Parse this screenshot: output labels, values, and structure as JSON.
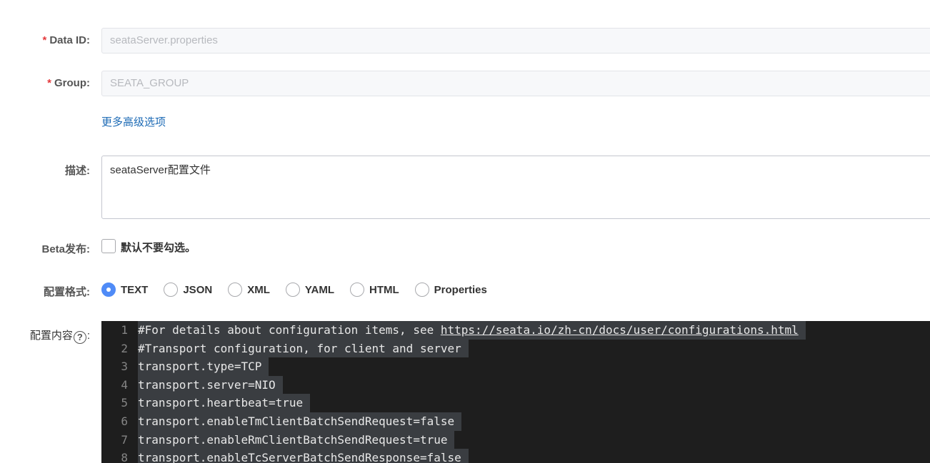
{
  "form": {
    "data_id": {
      "label": "Data ID:",
      "required": "*",
      "value": "seataServer.properties"
    },
    "group": {
      "label": "Group:",
      "required": "*",
      "value": "SEATA_GROUP"
    },
    "advanced_link": "更多高级选项",
    "description": {
      "label": "描述:",
      "value": "seataServer配置文件"
    },
    "beta": {
      "label": "Beta发布:",
      "checkbox_text": "默认不要勾选。",
      "checked": false
    },
    "format": {
      "label": "配置格式:",
      "options": [
        "TEXT",
        "JSON",
        "XML",
        "YAML",
        "HTML",
        "Properties"
      ],
      "selected": "TEXT"
    },
    "content": {
      "label": "配置内容",
      "help_glyph": "?",
      "colon": ":"
    }
  },
  "editor": {
    "lines": [
      {
        "no": "1",
        "prefix": "#For details about configuration items, see ",
        "link": "https://seata.io/zh-cn/docs/user/configurations.html"
      },
      {
        "no": "2",
        "prefix": "#Transport configuration, for client and server",
        "link": ""
      },
      {
        "no": "3",
        "prefix": "transport.type=TCP",
        "link": ""
      },
      {
        "no": "4",
        "prefix": "transport.server=NIO",
        "link": ""
      },
      {
        "no": "5",
        "prefix": "transport.heartbeat=true",
        "link": ""
      },
      {
        "no": "6",
        "prefix": "transport.enableTmClientBatchSendRequest=false",
        "link": ""
      },
      {
        "no": "7",
        "prefix": "transport.enableRmClientBatchSendRequest=true",
        "link": ""
      },
      {
        "no": "8",
        "prefix": "transport.enableTcServerBatchSendResponse=false",
        "link": ""
      }
    ]
  },
  "colors": {
    "required": "#e4393c",
    "link": "#1c6ab5",
    "radio_checked": "#4f8bf7",
    "editor_bg": "#1e1e1e"
  }
}
